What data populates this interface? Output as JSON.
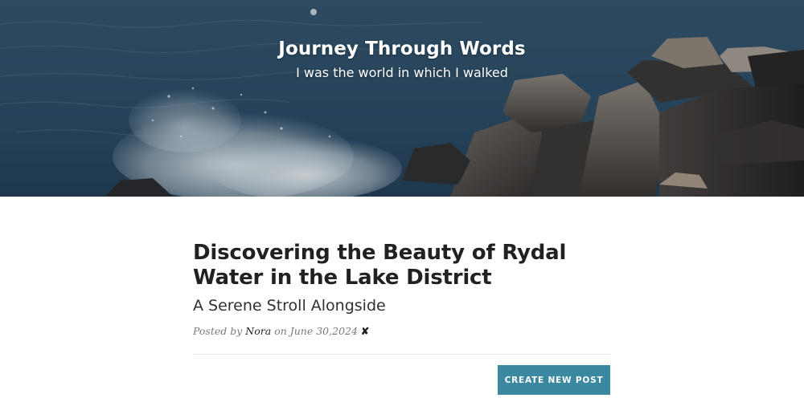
{
  "header": {
    "site_title": "Journey Through Words",
    "site_subtitle": "I was the world in which I walked",
    "background_image": "ocean-waves-on-rocks"
  },
  "post": {
    "title": "Discovering the Beauty of Rydal Water in the Lake District",
    "subtitle": "A Serene Stroll Alongside",
    "meta": {
      "posted_by_label": "Posted by",
      "author": "Nora",
      "on_label": "on",
      "date": "June 30,2024",
      "delete_icon": "✘"
    }
  },
  "actions": {
    "create_new_post_label": "CREATE NEW POST"
  },
  "colors": {
    "accent": "#3b88a1",
    "title_text": "#212121",
    "meta_text": "#7a7a7a"
  }
}
